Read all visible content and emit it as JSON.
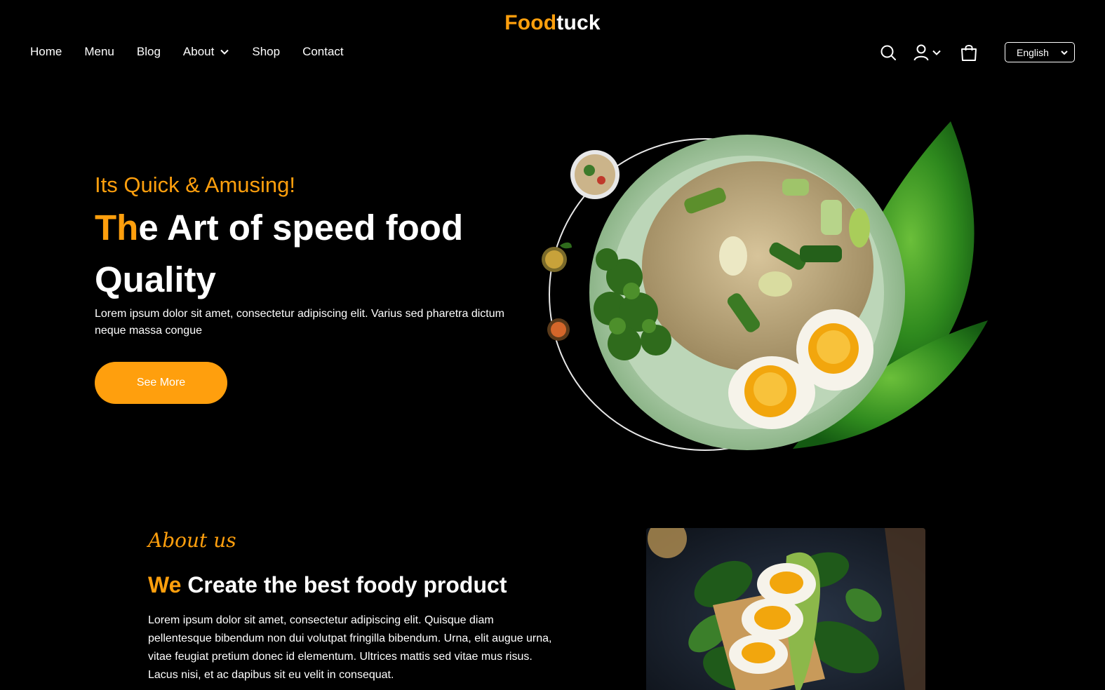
{
  "header": {
    "logo_accent": "Food",
    "logo_rest": "tuck",
    "nav": [
      {
        "label": "Home"
      },
      {
        "label": "Menu"
      },
      {
        "label": "Blog"
      },
      {
        "label": "About"
      },
      {
        "label": "Shop"
      },
      {
        "label": "Contact"
      }
    ],
    "language": "English",
    "icons": [
      "search-icon",
      "user-icon",
      "chevron-down-icon",
      "shopping-bag-icon"
    ]
  },
  "hero": {
    "eyebrow": "Its Quick & Amusing!",
    "title_accent": "Th",
    "title_rest": "e Art of speed food Quality",
    "description": "Lorem ipsum dolor sit amet, consectetur adipiscing elit. Varius sed pharetra dictum neque massa congue",
    "cta": "See More"
  },
  "about": {
    "eyebrow": "About us",
    "title_accent": "We",
    "title_rest": " Create the best foody product",
    "description": "Lorem ipsum dolor sit amet, consectetur adipiscing elit. Quisque diam pellentesque bibendum non dui volutpat fringilla bibendum. Urna, elit augue urna, vitae feugiat pretium donec id elementum. Ultrices mattis sed vitae mus risus. Lacus nisi, et ac dapibus sit eu velit in consequat."
  },
  "colors": {
    "accent": "#ff9f0d",
    "background": "#000000",
    "text": "#ffffff"
  }
}
